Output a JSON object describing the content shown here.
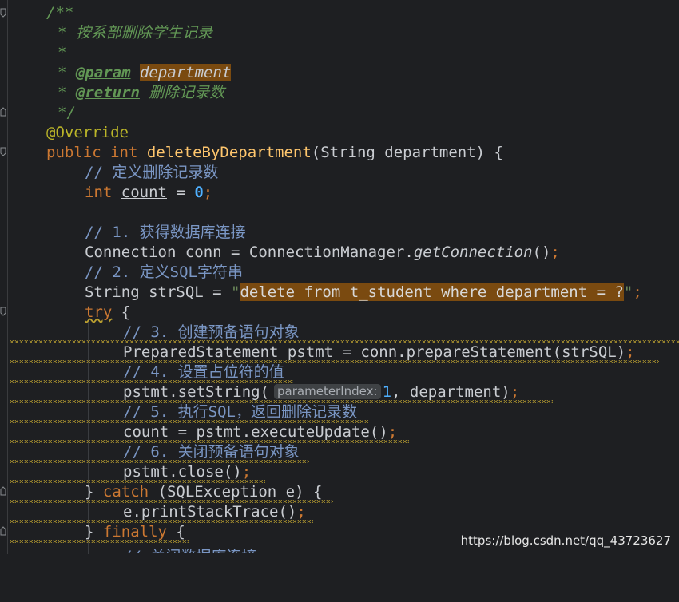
{
  "editor": {
    "doc": {
      "open": "/**",
      "summary": "* 按系部删除学生记录",
      "blank": "*",
      "param_tag": "@param",
      "param_name": "department",
      "return_tag": "@return",
      "return_desc": "删除记录数",
      "close": "*/"
    },
    "annotation": "@Override",
    "signature": {
      "kw_public": "public",
      "kw_int": "int",
      "method": "deleteByDepartment",
      "params": "(String department) {"
    },
    "body": {
      "c_define": "// 定义删除记录数",
      "kw_int": "int",
      "var_count": "count",
      "assign": " = ",
      "zero": "0",
      "semi": ";",
      "c_step1": "// 1. 获得数据库连接",
      "conn_decl": "Connection conn = ConnectionManager.",
      "conn_method": "getConnection",
      "conn_end": "()",
      "c_step2": "// 2. 定义SQL字符串",
      "sql_decl": "String strSQL = ",
      "sql_quote": "\"",
      "sql_text": "delete from t_student where department = ?",
      "kw_try": "try",
      "brace_open": " {",
      "c_step3": "// 3. 创建预备语句对象",
      "prep_decl": "PreparedStatement pstmt = conn.prepareStatement(strSQL)",
      "c_step4": "// 4. 设置占位符的值",
      "set_call": "pstmt.setString(",
      "hint_label": "parameterIndex:",
      "hint_value": "1",
      "set_rest": ", department)",
      "c_step5": "// 5. 执行SQL，返回删除记录数",
      "exec": "count = pstmt.executeUpdate()",
      "c_step6": "// 6. 关闭预备语句对象",
      "close_call": "pstmt.close()",
      "catch_open": "} ",
      "kw_catch": "catch",
      "catch_rest": " (SQLException e) {",
      "print_trace": "e.printStackTrace()",
      "finally_open": "} ",
      "kw_finally": "finally",
      "c_step7_partial": "// 关闭数据库连接"
    }
  },
  "watermark": "https://blog.csdn.net/qq_43723627",
  "colors": {
    "background": "#1e1f22",
    "keyword": "#cc7832",
    "method": "#ffc66d",
    "comment": "#629755",
    "line_comment": "#7a96c4",
    "highlight": "#7a4a10"
  }
}
